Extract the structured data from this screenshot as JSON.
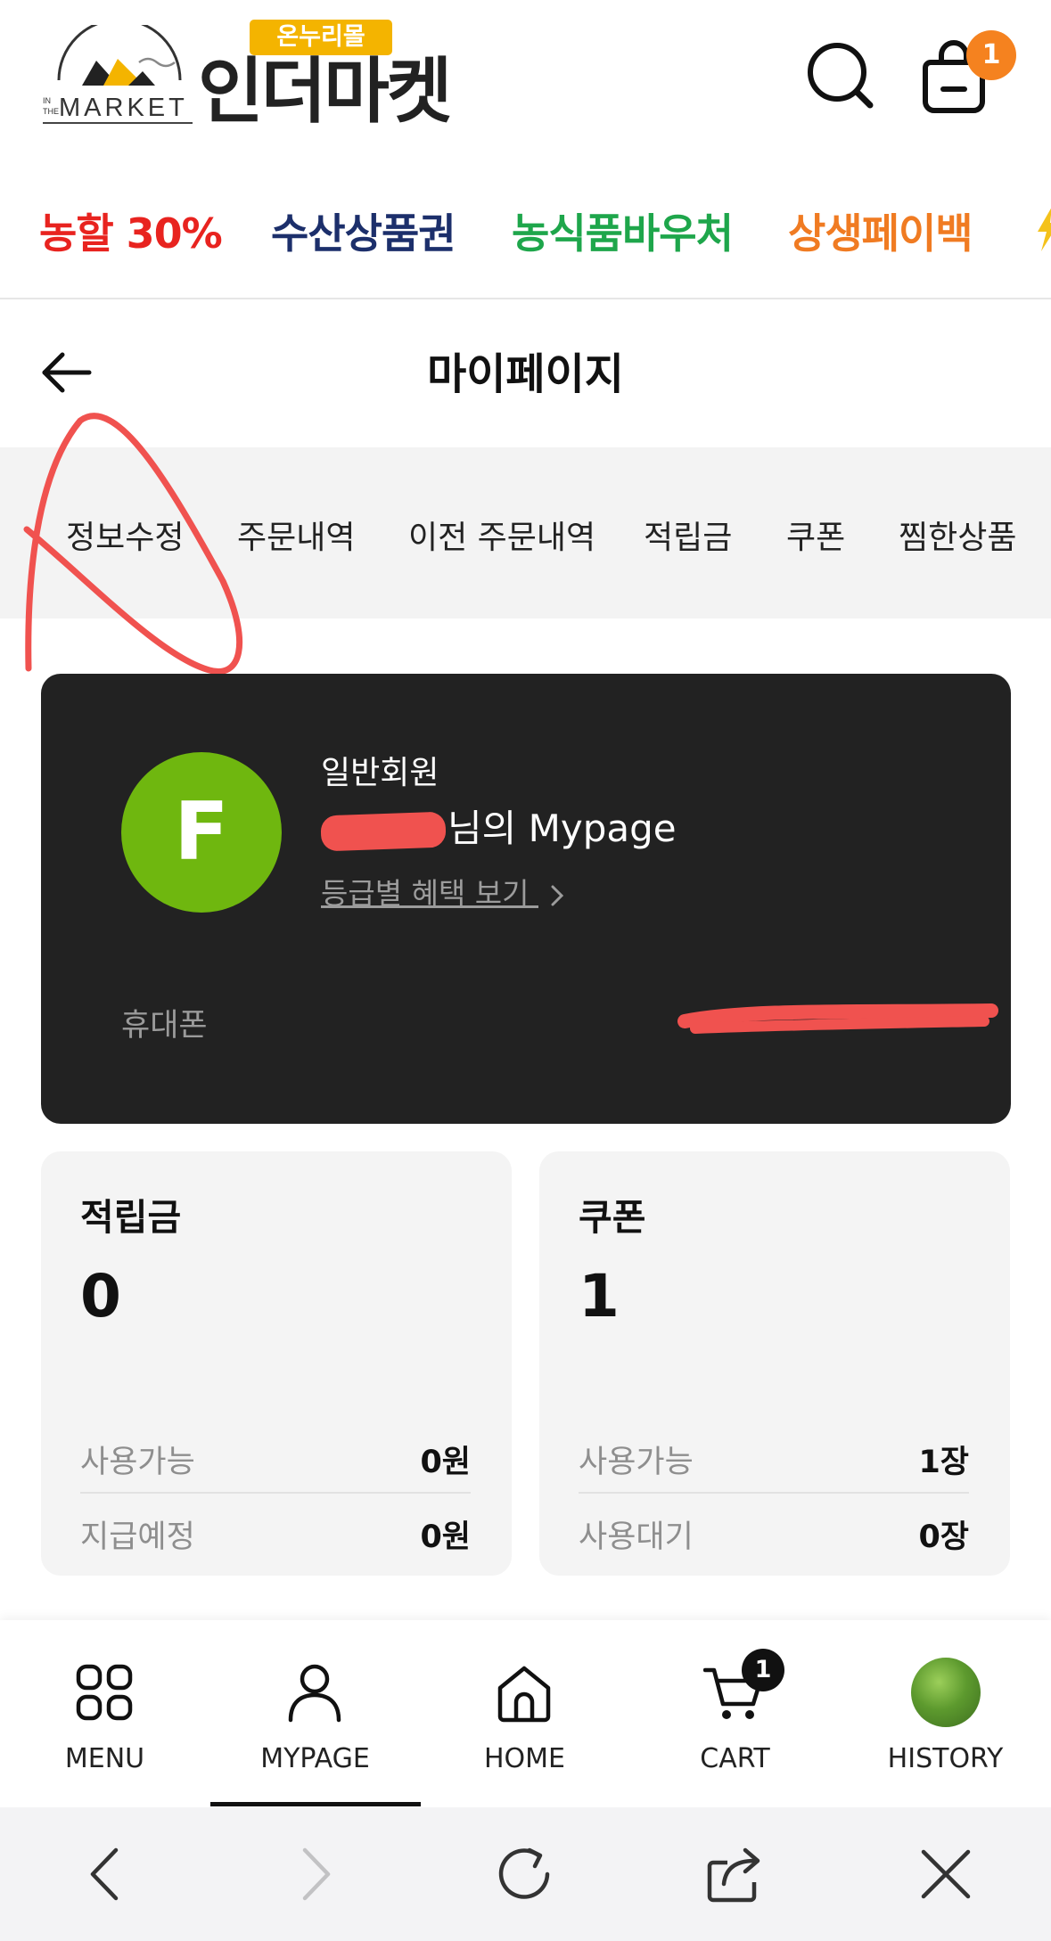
{
  "header": {
    "badge": "온누리몰",
    "logo_small": "MARKET",
    "logo_small_prefix_top": "IN",
    "logo_small_prefix_bottom": "THE",
    "brand": "인더마켓",
    "bag_count": "1"
  },
  "promo": [
    {
      "label": "농할 30%",
      "color": "#e8231f"
    },
    {
      "label": "수산상품권",
      "color": "#1c2f6b"
    },
    {
      "label": "농식품바우처",
      "color": "#1ea64b"
    },
    {
      "label": "상생페이백",
      "color": "#f07b22"
    }
  ],
  "titlebar": {
    "title": "마이페이지"
  },
  "tabs": [
    "정보수정",
    "주문내역",
    "이전 주문내역",
    "적립금",
    "쿠폰",
    "찜한상품"
  ],
  "profile": {
    "avatar_letter": "F",
    "grade": "일반회원",
    "greeting_suffix": "님의 Mypage",
    "benefit_link": "등급별 혜택 보기",
    "phone_label": "휴대폰"
  },
  "points": {
    "title": "적립금",
    "value": "0",
    "rows": [
      {
        "label": "사용가능",
        "value": "0원"
      },
      {
        "label": "지급예정",
        "value": "0원"
      }
    ]
  },
  "coupons": {
    "title": "쿠폰",
    "value": "1",
    "rows": [
      {
        "label": "사용가능",
        "value": "1장"
      },
      {
        "label": "사용대기",
        "value": "0장"
      }
    ]
  },
  "bottom_nav": {
    "items": [
      "MENU",
      "MYPAGE",
      "HOME",
      "CART",
      "HISTORY"
    ],
    "active": "MYPAGE",
    "cart_count": "1"
  },
  "colors": {
    "accent": "#f5821f",
    "card_dark": "#222222",
    "avatar": "#6fb70f",
    "annotation": "#f0524f"
  }
}
